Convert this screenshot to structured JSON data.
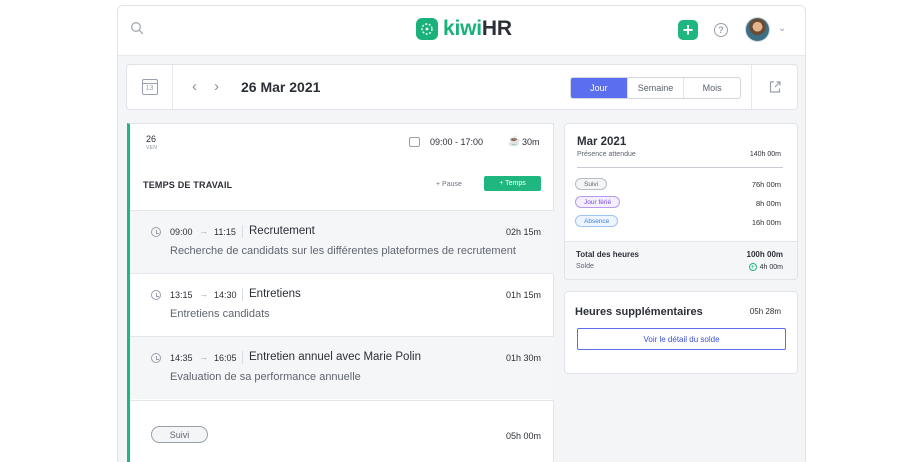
{
  "header": {
    "logo_kiwi": "kiwi",
    "logo_hr": "HR",
    "add_label": "+"
  },
  "datebar": {
    "calendar_day": "13",
    "current_date": "26 Mar 2021",
    "views": [
      {
        "label": "Jour",
        "active": true
      },
      {
        "label": "Semaine",
        "active": false
      },
      {
        "label": "Mois",
        "active": false
      }
    ]
  },
  "day": {
    "number": "26",
    "weekday": "VEN",
    "hours": "09:00 - 17:00",
    "pause_duration": "30m",
    "section_title": "TEMPS DE TRAVAIL",
    "add_pause_label": "+ Pause",
    "add_time_label": "+ Temps",
    "entries": [
      {
        "start": "09:00",
        "end": "11:15",
        "title": "Recrutement",
        "duration": "02h 15m",
        "description": "Recherche de candidats sur les différentes plateformes de recrutement"
      },
      {
        "start": "13:15",
        "end": "14:30",
        "title": "Entretiens",
        "duration": "01h 15m",
        "description": "Entretiens candidats"
      },
      {
        "start": "14:35",
        "end": "16:05",
        "title": "Entretien annuel avec Marie Polin",
        "duration": "01h 30m",
        "description": "Evaluation de sa performance annuelle"
      }
    ],
    "footer_status": "Suivi",
    "footer_duration": "05h 00m"
  },
  "month": {
    "title": "Mar 2021",
    "expected_label": "Présence attendue",
    "expected_value": "140h 00m",
    "rows": [
      {
        "label": "Suivi",
        "value": "76h 00m"
      },
      {
        "label": "Jour férié",
        "value": "8h 00m"
      },
      {
        "label": "Absence",
        "value": "16h 00m"
      }
    ],
    "total_label": "Total des heures",
    "total_value": "100h 00m",
    "balance_label": "Solde",
    "balance_value": "4h 00m"
  },
  "overtime": {
    "title": "Heures supplémentaires",
    "value": "05h 28m",
    "button_label": "Voir le détail du solde"
  },
  "colors": {
    "brand_green": "#1ab17b",
    "accent_blue": "#5b6ef0"
  }
}
